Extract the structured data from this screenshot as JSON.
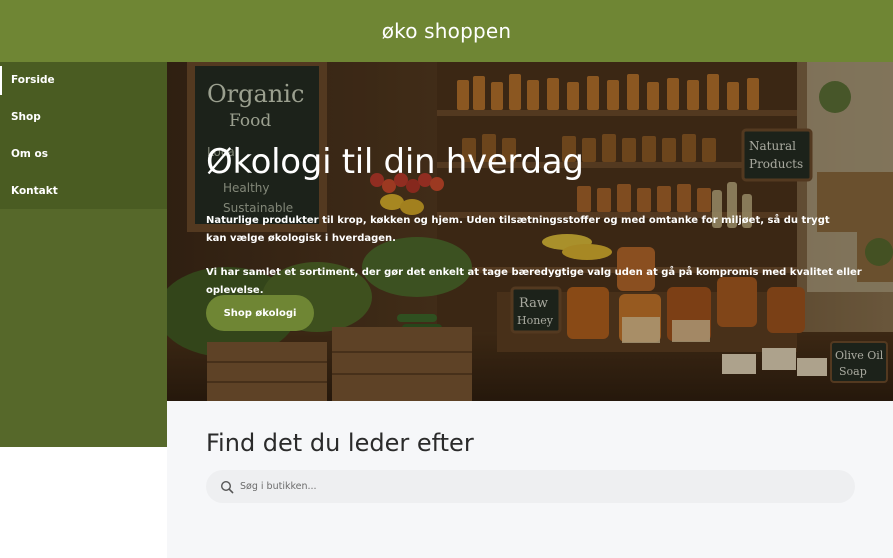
{
  "header": {
    "site_title": "øko shoppen"
  },
  "sidebar": {
    "items": [
      {
        "label": "Forside",
        "active": true
      },
      {
        "label": "Shop",
        "active": false
      },
      {
        "label": "Om os",
        "active": false
      },
      {
        "label": "Kontakt",
        "active": false
      }
    ]
  },
  "hero": {
    "heading": "Økologi til din hverdag",
    "paragraph1": "Naturlige produkter til krop, køkken og hjem. Uden tilsætningsstoffer og med omtanke for miljøet, så du trygt kan vælge økologisk i hverdagen.",
    "paragraph2": "Vi har samlet et sortiment, der gør det enkelt at tage bæredygtige valg uden at gå på kompromis med kvalitet eller oplevelse.",
    "button_label": "Shop økologi",
    "image_signs": {
      "chalkboard_line1": "Organic",
      "chalkboard_line2": "Food",
      "chalkboard_line3": "Local",
      "chalkboard_line4": "Healthy",
      "chalkboard_line5": "Sustainable",
      "natural_products_1": "Natural",
      "natural_products_2": "Products",
      "raw_honey_1": "Raw",
      "raw_honey_2": "Honey",
      "olive_soap_1": "Olive Oil",
      "olive_soap_2": "Soap"
    }
  },
  "search": {
    "title": "Find det du leder efter",
    "placeholder": "Søg i butikken..."
  },
  "colors": {
    "brand_green": "#6f8634",
    "sidebar_green": "#56682a",
    "nav_green": "#4a5c22"
  }
}
